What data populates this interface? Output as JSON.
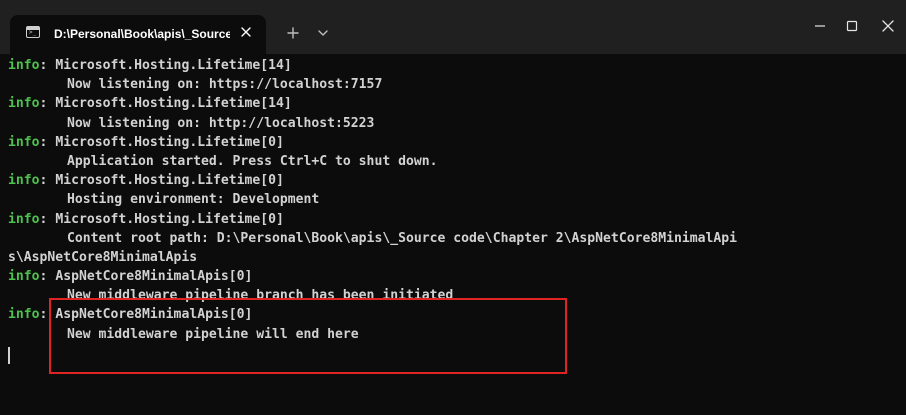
{
  "window": {
    "tab_title": "D:\\Personal\\Book\\apis\\_Source",
    "tab_icon": "terminal-icon",
    "tab_close_icon": "close-icon",
    "new_tab_icon": "plus-icon",
    "dropdown_icon": "chevron-down-icon",
    "controls": {
      "minimize_icon": "minimize-icon",
      "maximize_icon": "maximize-icon",
      "close_icon": "close-icon"
    }
  },
  "terminal": {
    "info_label": "info",
    "lines": [
      {
        "tag": "info",
        "text": ": Microsoft.Hosting.Lifetime[14]"
      },
      {
        "tag": "",
        "text": "Now listening on: https://localhost:7157"
      },
      {
        "tag": "info",
        "text": ": Microsoft.Hosting.Lifetime[14]"
      },
      {
        "tag": "",
        "text": "Now listening on: http://localhost:5223"
      },
      {
        "tag": "info",
        "text": ": Microsoft.Hosting.Lifetime[0]"
      },
      {
        "tag": "",
        "text": "Application started. Press Ctrl+C to shut down."
      },
      {
        "tag": "info",
        "text": ": Microsoft.Hosting.Lifetime[0]"
      },
      {
        "tag": "",
        "text": "Hosting environment: Development"
      },
      {
        "tag": "info",
        "text": ": Microsoft.Hosting.Lifetime[0]"
      },
      {
        "tag": "",
        "text": "Content root path: D:\\Personal\\Book\\apis\\_Source code\\Chapter 2\\AspNetCore8MinimalApi"
      },
      {
        "tag": "",
        "text": "s\\AspNetCore8MinimalApis"
      },
      {
        "tag": "info",
        "text": ": AspNetCore8MinimalApis[0]"
      },
      {
        "tag": "",
        "text": "New middleware pipeline branch has been initiated"
      },
      {
        "tag": "info",
        "text": ": AspNetCore8MinimalApis[0]"
      },
      {
        "tag": "",
        "text": "New middleware pipeline will end here"
      }
    ]
  },
  "colors": {
    "terminal_background": "#0c0c0c",
    "titlebar_background": "#202020",
    "text": "#d2d2d2",
    "info_green": "#4ec24e",
    "highlight_red": "#e02424"
  }
}
